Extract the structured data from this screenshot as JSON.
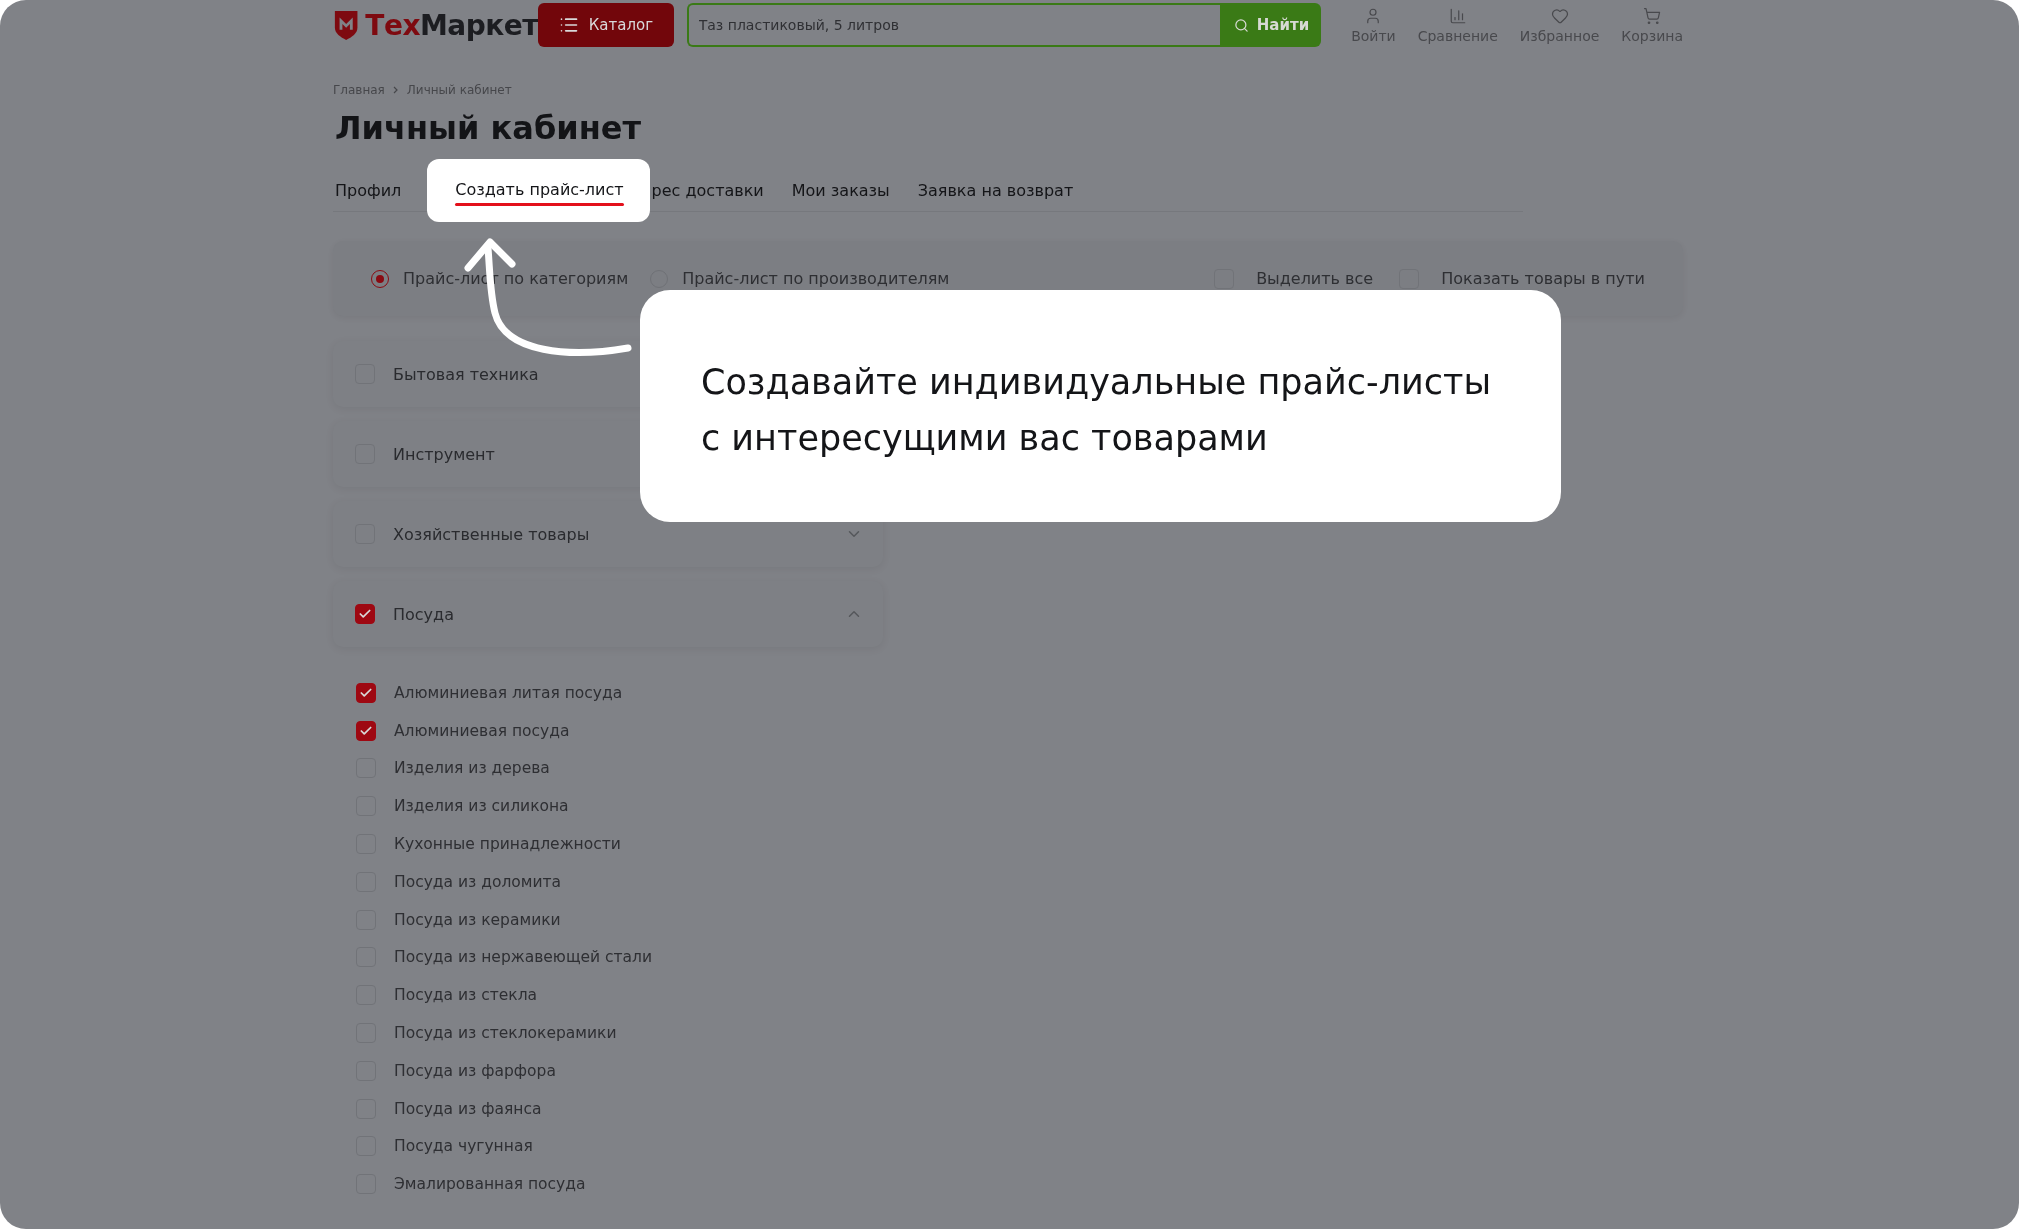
{
  "header": {
    "logo": {
      "accent": "Тех",
      "rest": "Маркет"
    },
    "catalog_button": "Каталог",
    "search": {
      "placeholder": "Таз пластиковый, 5 литров"
    },
    "search_button": "Найти",
    "actions": [
      {
        "kind": "user",
        "label": "Войти"
      },
      {
        "kind": "compare",
        "label": "Сравнение"
      },
      {
        "kind": "favorite",
        "label": "Избранное"
      },
      {
        "kind": "cart",
        "label": "Корзина"
      }
    ]
  },
  "breadcrumbs": [
    "Главная",
    "Личный кабинет"
  ],
  "title": "Личный кабинет",
  "tabs": [
    {
      "label": "Профил",
      "selected": false
    },
    {
      "label": "Создать прайс-лист",
      "selected": true
    },
    {
      "label": "рес доставки",
      "selected": false
    },
    {
      "label": "Мои заказы",
      "selected": false
    },
    {
      "label": "Заявка на возврат",
      "selected": false
    }
  ],
  "radios": [
    {
      "label": "Прайс-лист по категориям",
      "selected": true
    },
    {
      "label": "Прайс-лист по производителям",
      "selected": false
    }
  ],
  "options": [
    {
      "label": "Выделить все",
      "checked": false
    },
    {
      "label": "Показать товары в пути",
      "checked": false
    }
  ],
  "categories": [
    {
      "label": "Бытовая техника",
      "checked": false
    },
    {
      "label": "Инструмент",
      "checked": false
    },
    {
      "label": "Хозяйственные товары",
      "checked": false,
      "expanded": false
    },
    {
      "label": "Посуда",
      "checked": true,
      "expanded": true,
      "children": [
        {
          "label": "Алюминиевая литая посуда",
          "checked": true
        },
        {
          "label": "Алюминиевая посуда",
          "checked": true
        },
        {
          "label": "Изделия из дерева",
          "checked": false
        },
        {
          "label": "Изделия из силикона",
          "checked": false
        },
        {
          "label": "Кухонные принадлежности",
          "checked": false
        },
        {
          "label": "Посуда из доломита",
          "checked": false
        },
        {
          "label": "Посуда из керамики",
          "checked": false
        },
        {
          "label": "Посуда из нержавеющей стали",
          "checked": false
        },
        {
          "label": "Посуда из стекла",
          "checked": false
        },
        {
          "label": "Посуда из стеклокерамики",
          "checked": false
        },
        {
          "label": "Посуда из фарфора",
          "checked": false
        },
        {
          "label": "Посуда из фаянса",
          "checked": false
        },
        {
          "label": "Посуда чугунная",
          "checked": false
        },
        {
          "label": "Эмалированная посуда",
          "checked": false
        }
      ]
    }
  ],
  "callout": {
    "text": "Создавайте индивидуальные прайс-листы\nс интересущими вас товарами"
  }
}
